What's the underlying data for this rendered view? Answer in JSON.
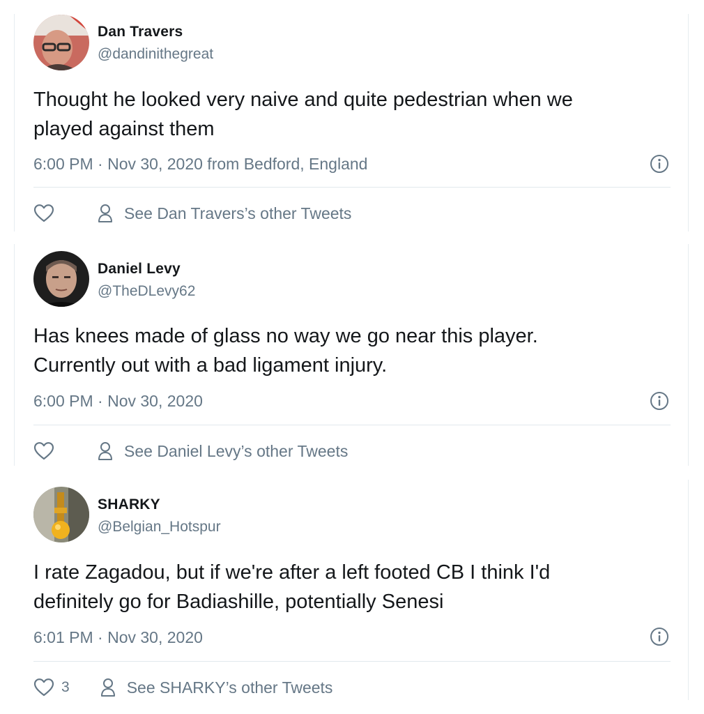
{
  "tweets": [
    {
      "name": "Dan Travers",
      "handle": "@dandinithegreat",
      "text_line1": "Thought he looked very naive and quite pedestrian when we",
      "text_line2": "played against them",
      "meta": "6:00 PM · Nov 30, 2020 from Bedford, England",
      "like_count": "",
      "other_tweets": "See Dan Travers’s other Tweets",
      "avatar_icon": "avatar-photo"
    },
    {
      "name": "Daniel Levy",
      "handle": "@TheDLevy62",
      "text_line1": "Has knees made of glass no way we go near this player.",
      "text_line2": "Currently out with a bad ligament injury.",
      "meta": "6:00 PM · Nov 30, 2020",
      "like_count": "",
      "other_tweets": "See Daniel Levy’s other Tweets",
      "avatar_icon": "avatar-photo"
    },
    {
      "name": "SHARKY",
      "handle": "@Belgian_Hotspur",
      "text_line1": "I rate Zagadou, but if we're after a left footed CB I think I'd",
      "text_line2": "definitely go for Badiashille, potentially Senesi",
      "meta": "6:01 PM · Nov 30, 2020",
      "like_count": "3",
      "other_tweets": "See SHARKY’s other Tweets",
      "avatar_icon": "avatar-photo"
    }
  ],
  "icons": {
    "like": "heart-icon",
    "info": "info-icon",
    "profile": "person-icon"
  },
  "colors": {
    "text": "#14171a",
    "secondary": "#657786",
    "divider": "#e1e8ed"
  }
}
